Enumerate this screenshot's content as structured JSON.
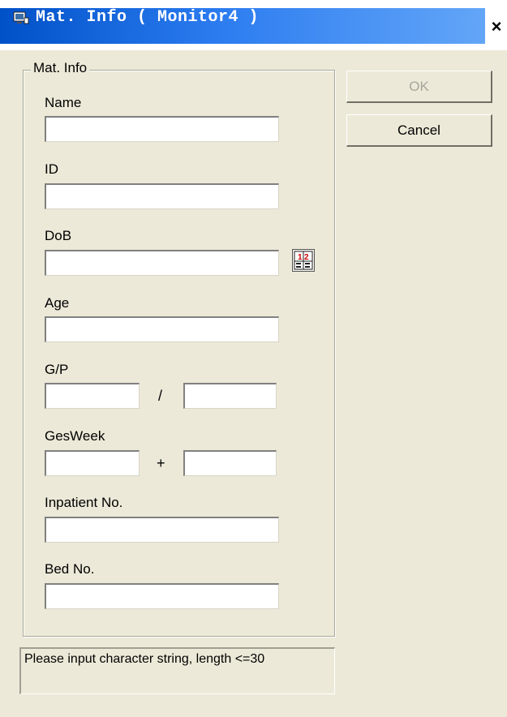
{
  "window": {
    "title": "Mat. Info ( Monitor4 )",
    "close_label": "×"
  },
  "group": {
    "legend": "Mat. Info"
  },
  "fields": {
    "name": {
      "label": "Name",
      "value": ""
    },
    "id": {
      "label": "ID",
      "value": ""
    },
    "dob": {
      "label": "DoB",
      "value": ""
    },
    "age": {
      "label": "Age",
      "value": ""
    },
    "gp": {
      "label": "G/P",
      "separator": "/",
      "value_g": "",
      "value_p": ""
    },
    "gesweek": {
      "label": "GesWeek",
      "separator": "+",
      "value_weeks": "",
      "value_days": ""
    },
    "inpatient": {
      "label": "Inpatient No.",
      "value": ""
    },
    "bed": {
      "label": "Bed No.",
      "value": ""
    }
  },
  "buttons": {
    "ok": "OK",
    "cancel": "Cancel"
  },
  "status": {
    "text": "Please input character string, length <=30"
  },
  "icons": {
    "title": "monitor-icon",
    "calendar": "calendar-icon"
  }
}
